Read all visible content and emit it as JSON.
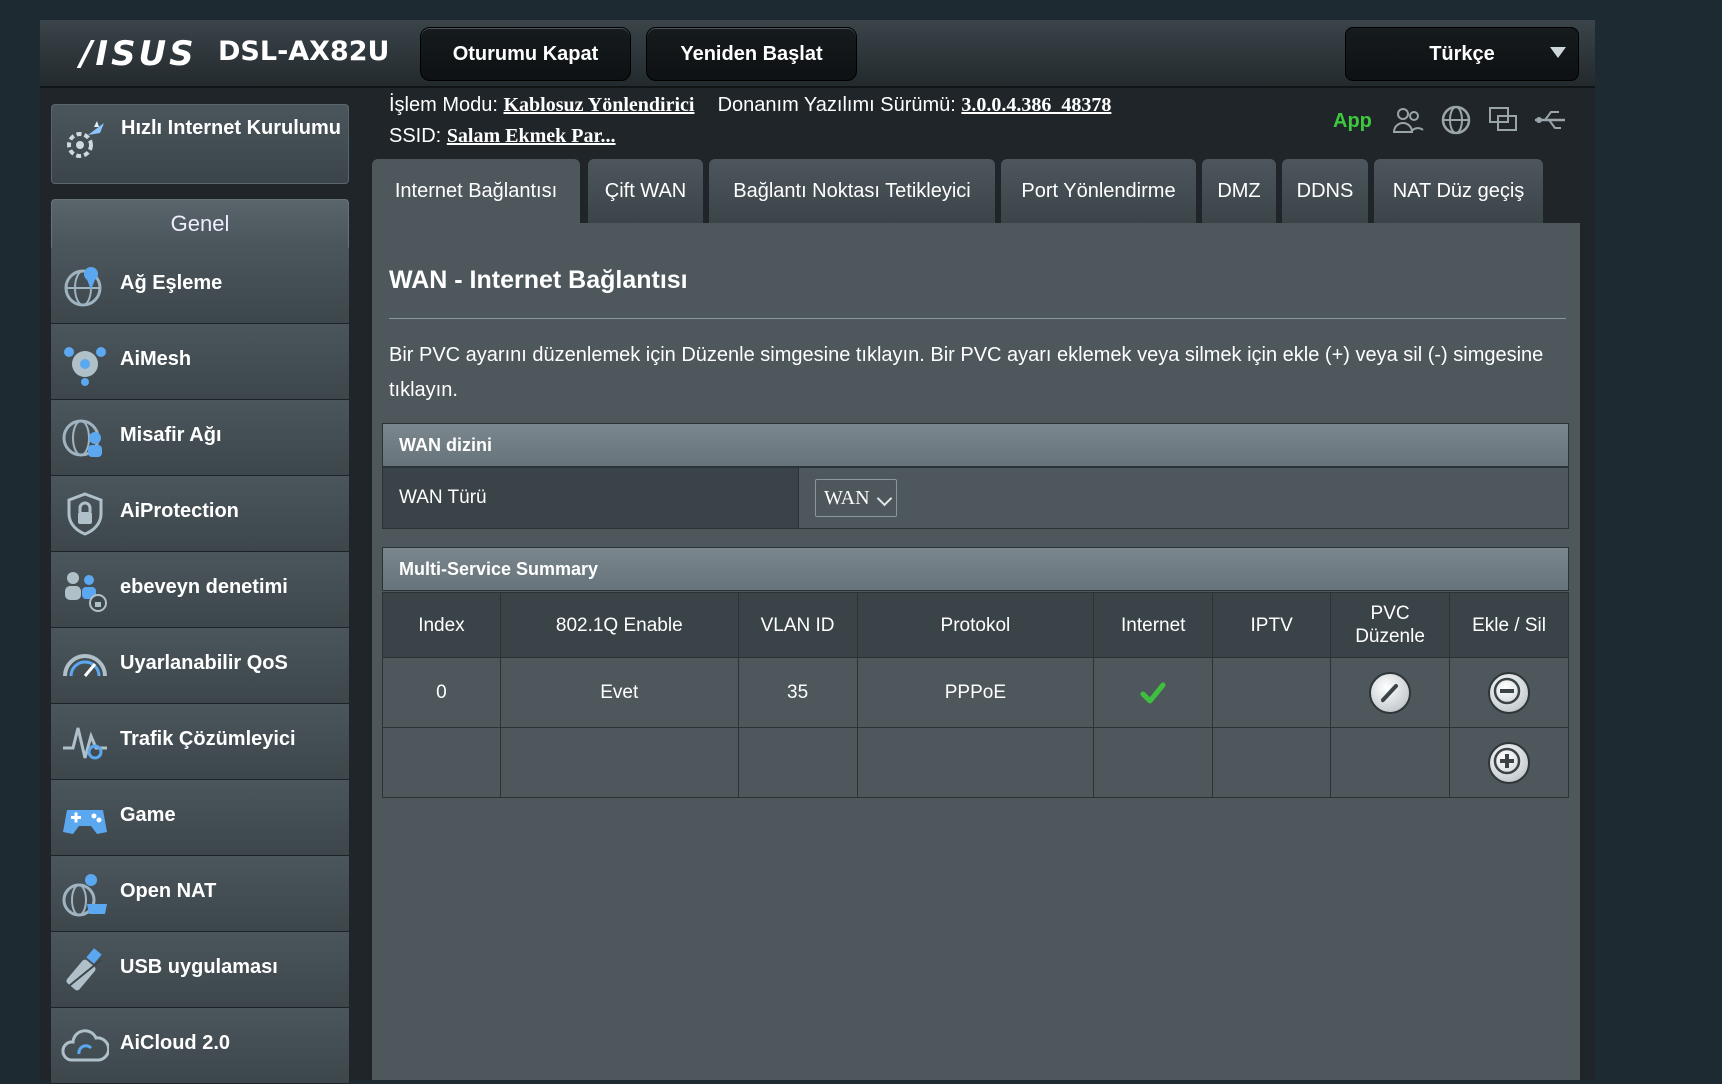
{
  "header": {
    "brand": "/ISUS",
    "model": "DSL-AX82U",
    "logout_label": "Oturumu Kapat",
    "reboot_label": "Yeniden Başlat",
    "language": "Türkçe"
  },
  "info": {
    "mode_label": "İşlem Modu:",
    "mode_value": "Kablosuz Yönlendirici",
    "firmware_label": "Donanım Yazılımı Sürümü:",
    "firmware_value": "3.0.0.4.386_48378",
    "ssid_label": "SSID:",
    "ssid_value": "Salam Ekmek Par...",
    "app_label": "App",
    "status_icons": [
      "clients-icon",
      "globe-icon",
      "devices-icon",
      "usb-icon"
    ]
  },
  "sidebar": {
    "quick_setup": "Hızlı Internet Kurulumu",
    "section_title": "Genel",
    "items": [
      {
        "label": "Ağ Eşleme",
        "icon": "network-map-icon"
      },
      {
        "label": "AiMesh",
        "icon": "aimesh-icon"
      },
      {
        "label": "Misafir Ağı",
        "icon": "guest-network-icon"
      },
      {
        "label": "AiProtection",
        "icon": "shield-lock-icon"
      },
      {
        "label": "ebeveyn denetimi",
        "icon": "parental-control-icon"
      },
      {
        "label": "Uyarlanabilir QoS",
        "icon": "gauge-icon"
      },
      {
        "label": "Trafik Çözümleyici",
        "icon": "traffic-analyzer-icon"
      },
      {
        "label": "Game",
        "icon": "gamepad-icon"
      },
      {
        "label": "Open NAT",
        "icon": "open-nat-icon"
      },
      {
        "label": "USB uygulaması",
        "icon": "usb-app-icon"
      },
      {
        "label": "AiCloud 2.0",
        "icon": "cloud-icon"
      }
    ]
  },
  "tabs": [
    {
      "label": "Internet Bağlantısı",
      "active": true
    },
    {
      "label": "Çift WAN"
    },
    {
      "label": "Bağlantı Noktası Tetikleyici"
    },
    {
      "label": "Port Yönlendirme"
    },
    {
      "label": "DMZ"
    },
    {
      "label": "DDNS"
    },
    {
      "label": "NAT Düz geçiş"
    }
  ],
  "page": {
    "title": "WAN - Internet Bağlantısı",
    "description": "Bir PVC ayarını düzenlemek için Düzenle simgesine tıklayın. Bir PVC ayarı eklemek veya silmek için ekle (+) veya sil (-) simgesine tıklayın."
  },
  "wan_index": {
    "heading": "WAN dizini",
    "type_label": "WAN Türü",
    "type_value": "WAN"
  },
  "summary": {
    "heading": "Multi-Service Summary",
    "columns": [
      "Index",
      "802.1Q Enable",
      "VLAN ID",
      "Protokol",
      "Internet",
      "IPTV",
      "PVC Düzenle",
      "Ekle / Sil"
    ],
    "rows": [
      {
        "index": "0",
        "enable": "Evet",
        "vlan": "35",
        "protocol": "PPPoE",
        "internet": "checkmark-icon",
        "iptv": ""
      }
    ]
  }
}
